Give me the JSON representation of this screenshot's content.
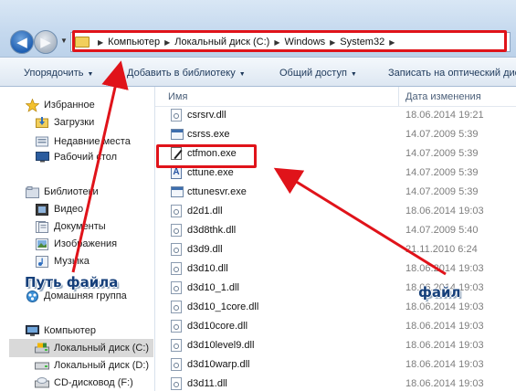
{
  "address_bar": {
    "breadcrumbs": [
      "Компьютер",
      "Локальный диск (C:)",
      "Windows",
      "System32"
    ]
  },
  "toolbar": {
    "items": [
      "Упорядочить",
      "Добавить в библиотеку",
      "Общий доступ",
      "Записать на оптический диск"
    ]
  },
  "nav": {
    "favorites": {
      "label": "Избранное",
      "items": [
        "Загрузки",
        "Недавние места",
        "Рабочий стол"
      ]
    },
    "libraries": {
      "label": "Библиотеки",
      "items": [
        "Видео",
        "Документы",
        "Изображения",
        "Музыка"
      ]
    },
    "homegroup": "Домашняя группа",
    "computer": {
      "label": "Компьютер",
      "items": [
        "Локальный диск (C:)",
        "Локальный диск (D:)",
        "CD-дисковод (F:)"
      ]
    }
  },
  "file_list": {
    "columns": {
      "name": "Имя",
      "date": "Дата изменения"
    },
    "rows": [
      {
        "name": "csrsrv.dll",
        "date": "18.06.2014 19:21",
        "icon": "dll-icon"
      },
      {
        "name": "csrss.exe",
        "date": "14.07.2009 5:39",
        "icon": "exe-icon"
      },
      {
        "name": "ctfmon.exe",
        "date": "14.07.2009 5:39",
        "icon": "ctfmon-pen-icon"
      },
      {
        "name": "cttune.exe",
        "date": "14.07.2009 5:39",
        "icon": "cleartype-icon"
      },
      {
        "name": "cttunesvr.exe",
        "date": "14.07.2009 5:39",
        "icon": "exe-icon"
      },
      {
        "name": "d2d1.dll",
        "date": "18.06.2014 19:03",
        "icon": "dll-icon"
      },
      {
        "name": "d3d8thk.dll",
        "date": "14.07.2009 5:40",
        "icon": "dll-icon"
      },
      {
        "name": "d3d9.dll",
        "date": "21.11.2010 6:24",
        "icon": "dll-icon"
      },
      {
        "name": "d3d10.dll",
        "date": "18.06.2014 19:03",
        "icon": "dll-icon"
      },
      {
        "name": "d3d10_1.dll",
        "date": "18.06.2014 19:03",
        "icon": "dll-icon"
      },
      {
        "name": "d3d10_1core.dll",
        "date": "18.06.2014 19:03",
        "icon": "dll-icon"
      },
      {
        "name": "d3d10core.dll",
        "date": "18.06.2014 19:03",
        "icon": "dll-icon"
      },
      {
        "name": "d3d10level9.dll",
        "date": "18.06.2014 19:03",
        "icon": "dll-icon"
      },
      {
        "name": "d3d10warp.dll",
        "date": "18.06.2014 19:03",
        "icon": "dll-icon"
      },
      {
        "name": "d3d11.dll",
        "date": "18.06.2014 19:03",
        "icon": "dll-icon"
      }
    ]
  },
  "annotations": {
    "path_label": "Путь файла",
    "file_label": "файл",
    "color": "#e0131a"
  }
}
